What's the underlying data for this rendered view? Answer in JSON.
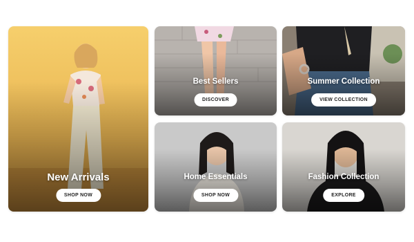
{
  "cards": [
    {
      "title": "New Arrivals",
      "button": "SHOP NOW",
      "image": "woman-in-yellow-outfit-photo"
    },
    {
      "title": "Best Sellers",
      "button": "DISCOVER",
      "image": "legs-in-floral-skirt-photo"
    },
    {
      "title": "Summer Collection",
      "button": "VIEW COLLECTION",
      "image": "denim-and-bracelets-photo"
    },
    {
      "title": "Home Essentials",
      "button": "SHOP NOW",
      "image": "woman-in-white-sweater-photo"
    },
    {
      "title": "Fashion Collection",
      "button": "EXPLORE",
      "image": "woman-in-black-jacket-photo"
    }
  ],
  "colors": {
    "button_bg": "#ffffff",
    "button_text": "#222222",
    "title_text": "#ffffff"
  }
}
